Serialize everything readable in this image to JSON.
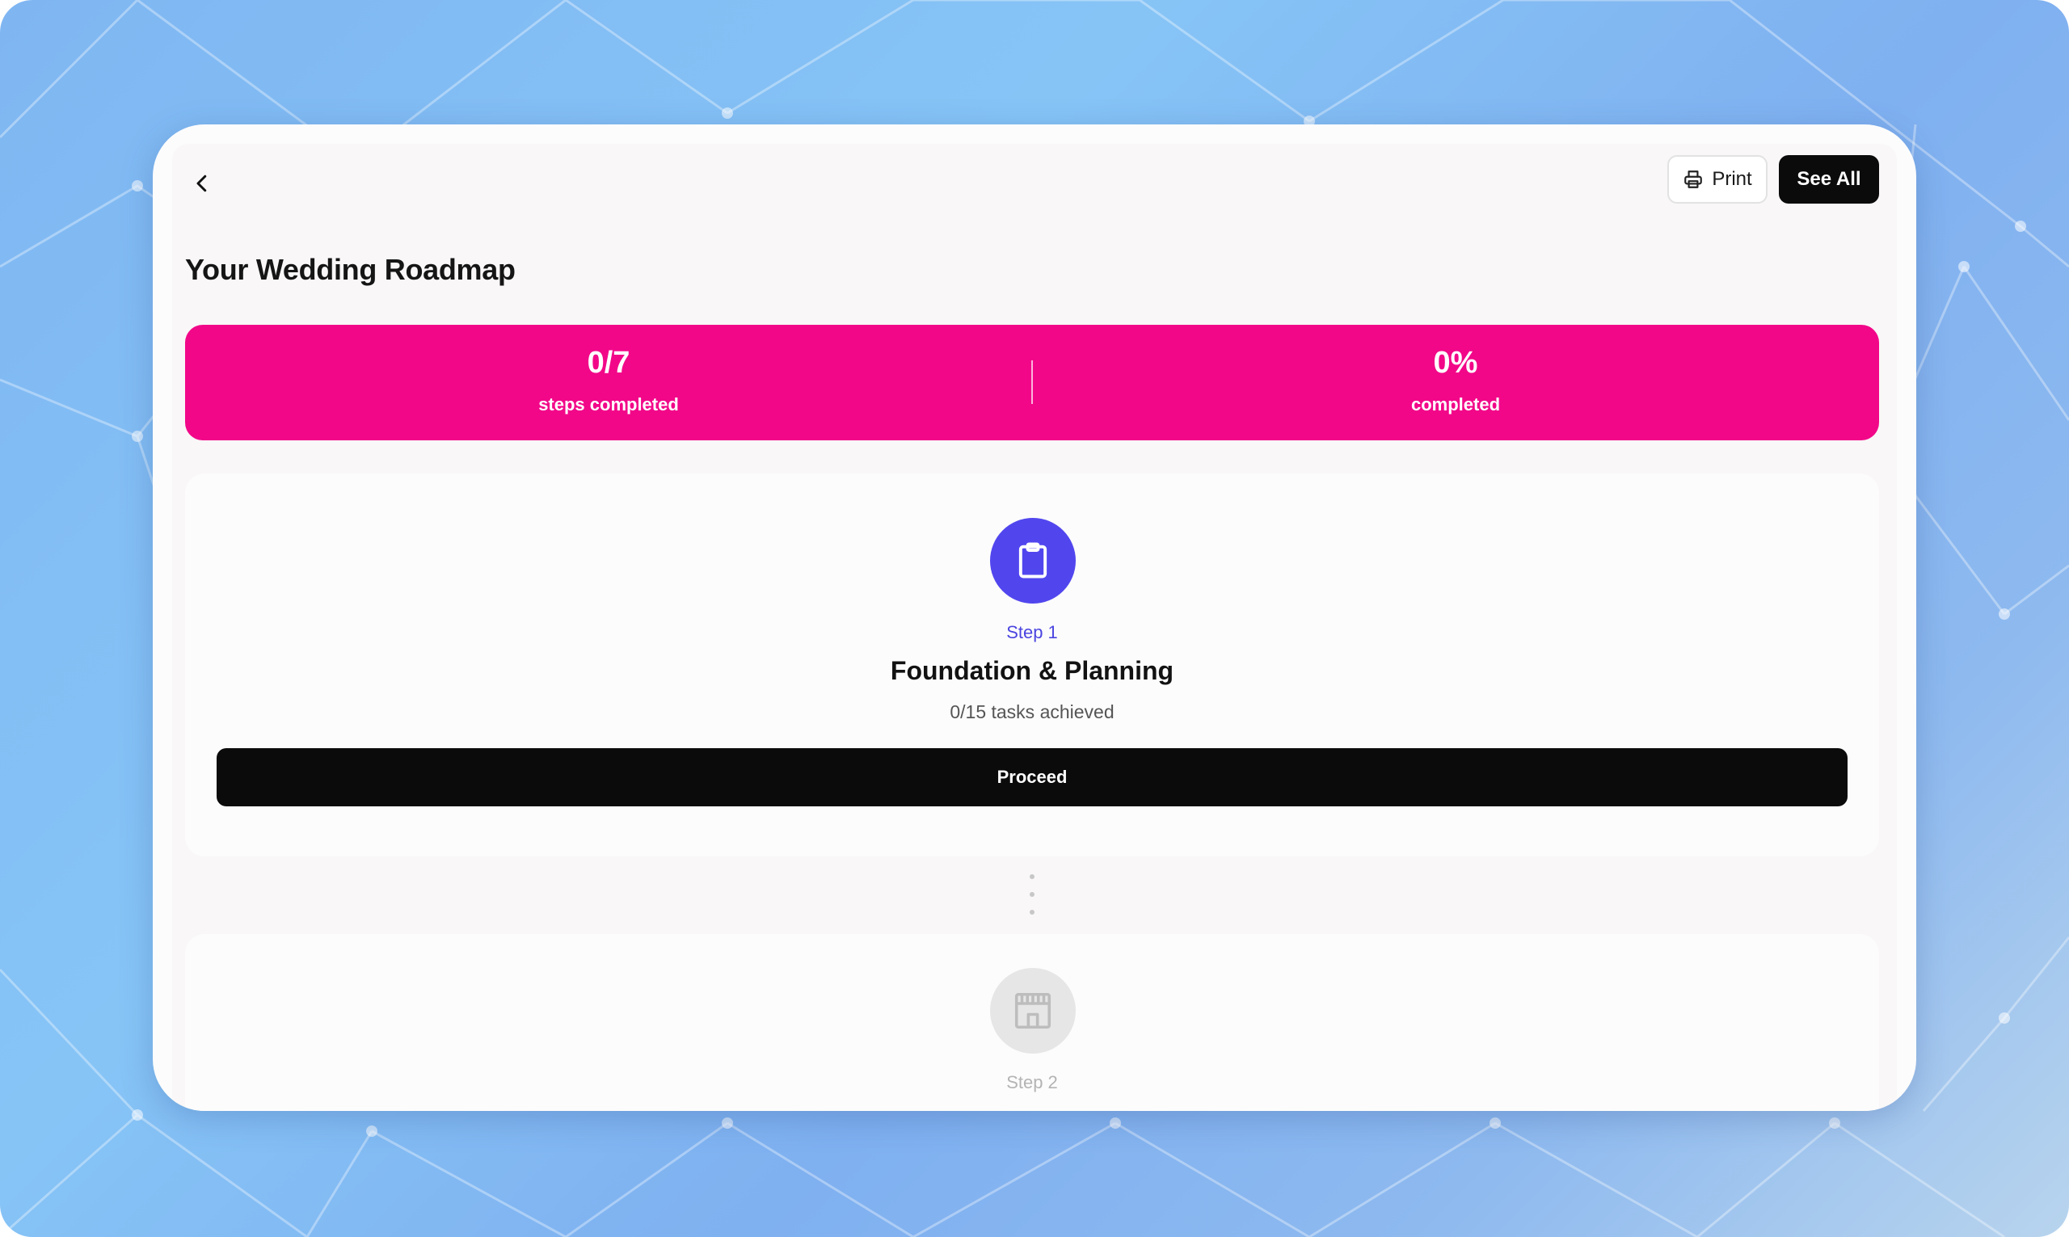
{
  "header": {
    "back_icon": "chevron-left-icon",
    "print_label": "Print",
    "print_icon": "printer-icon",
    "see_all_label": "See All"
  },
  "page": {
    "title": "Your Wedding Roadmap"
  },
  "stats": {
    "steps_value": "0/7",
    "steps_label": "steps completed",
    "percent_value": "0%",
    "percent_label": "completed",
    "accent_color": "#f20789"
  },
  "steps": [
    {
      "step_label": "Step 1",
      "title": "Foundation & Planning",
      "tasks_text": "0/15 tasks achieved",
      "action_label": "Proceed",
      "icon": "clipboard-icon",
      "icon_color": "#5146ee",
      "active": true
    },
    {
      "step_label": "Step 2",
      "icon": "venue-building-icon",
      "icon_color": "#e6e6e6",
      "active": false
    }
  ]
}
